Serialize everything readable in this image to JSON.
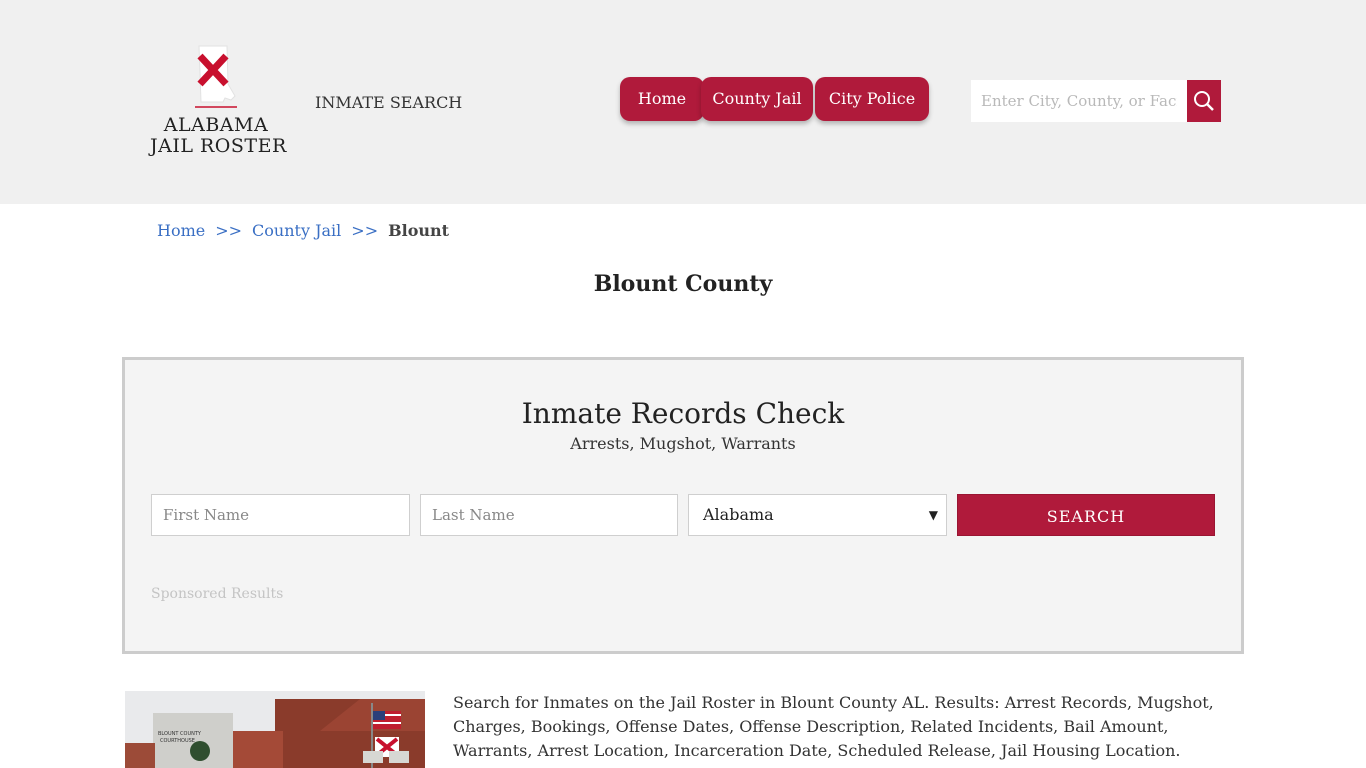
{
  "header": {
    "logo_line1": "ALABAMA",
    "logo_line2": "JAIL ROSTER",
    "inmate_search_link": "INMATE SEARCH",
    "nav": [
      {
        "label": "Home"
      },
      {
        "label": "County Jail"
      },
      {
        "label": "City Police"
      }
    ],
    "search_placeholder": "Enter City, County, or Facility"
  },
  "breadcrumb": {
    "home": "Home",
    "sep": ">>",
    "county_jail": "County Jail",
    "current": "Blount"
  },
  "page_title": "Blount County",
  "records_check": {
    "title": "Inmate Records Check",
    "subtitle": "Arrests, Mugshot, Warrants",
    "first_name_placeholder": "First Name",
    "last_name_placeholder": "Last Name",
    "state_selected": "Alabama",
    "search_button": "SEARCH",
    "sponsored": "Sponsored Results"
  },
  "courthouse_image": {
    "sign_line1": "BLOUNT COUNTY",
    "sign_line2": "COURTHOUSE"
  },
  "description": "Search for Inmates on the Jail Roster in Blount County AL. Results: Arrest Records, Mugshot, Charges, Bookings, Offense Dates, Offense Description, Related Incidents, Bail Amount, Warrants, Arrest Location, Incarceration Date, Scheduled Release, Jail Housing Location.",
  "colors": {
    "brand": "#b01a3b",
    "header_bg": "#f0f0f0",
    "link": "#3a6fc4"
  }
}
